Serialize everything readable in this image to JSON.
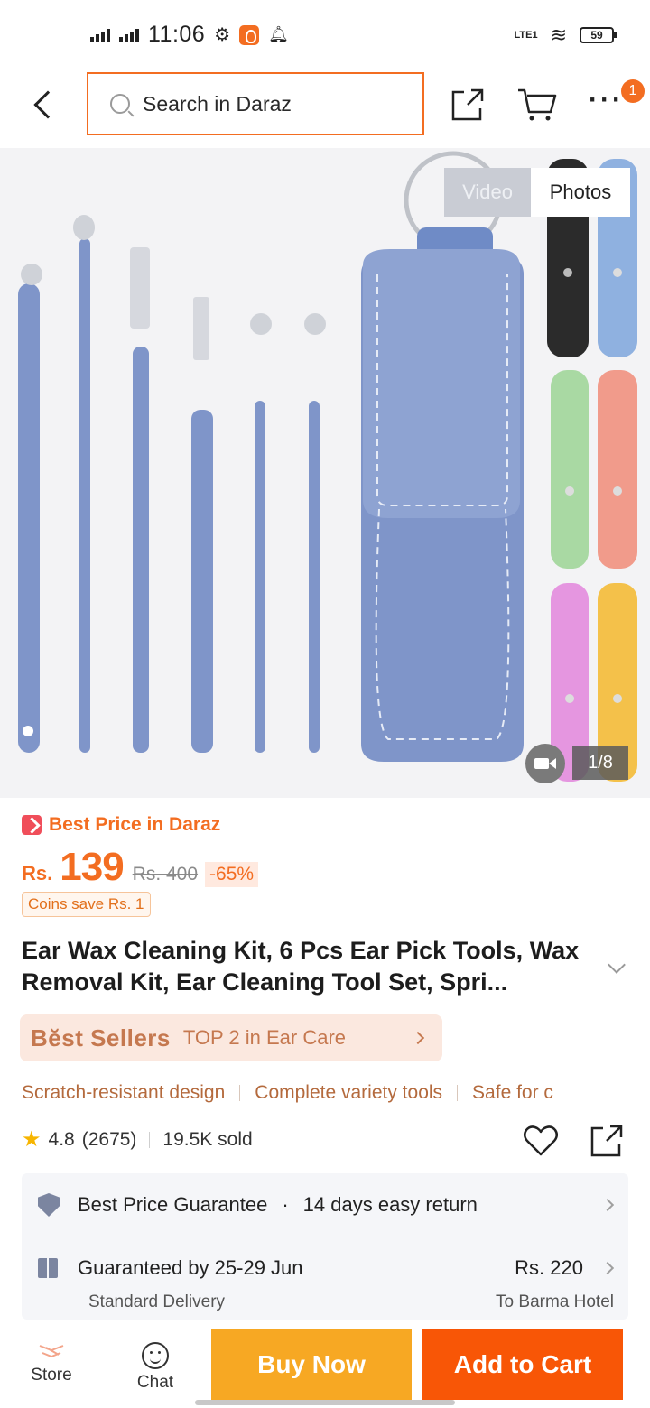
{
  "status_bar": {
    "time": "11:06",
    "network": "LTE1",
    "battery": "59"
  },
  "header": {
    "search_placeholder": "Search in Daraz",
    "cart_badge": "1"
  },
  "gallery": {
    "media_tabs": [
      "Video",
      "Photos"
    ],
    "active_tab": "Photos",
    "counter": "1/8",
    "case_colors": [
      "#5c7ec0",
      "#7f95c9",
      "#2b2b2b",
      "#8fb1e0",
      "#a9d9a3",
      "#f19b8b",
      "#e596e0",
      "#f4c14a"
    ]
  },
  "price": {
    "promo_label": "Best Price in Daraz",
    "currency": "Rs.",
    "current": "139",
    "original": "Rs. 400",
    "discount": "-65%",
    "coins": "Coins save Rs. 1"
  },
  "product": {
    "title": "Ear Wax Cleaning Kit, 6 Pcs Ear Pick Tools, Wax Removal Kit, Ear Cleaning Tool Set, Spri..."
  },
  "best_sellers": {
    "brand": "Bĕst Sellers",
    "rank": "TOP 2 in Ear Care"
  },
  "features": [
    "Scratch-resistant design",
    "Complete variety tools",
    "Safe for c"
  ],
  "rating": {
    "score": "4.8",
    "count": "(2675)",
    "sold": "19.5K sold"
  },
  "services": {
    "guarantee": "Best Price Guarantee",
    "return_policy": "14 days easy return",
    "delivery": "Guaranteed by 25-29 Jun",
    "delivery_fee": "Rs. 220",
    "delivery_type": "Standard Delivery",
    "destination": "To Barma Hotel"
  },
  "bottom_bar": {
    "store_label": "Store",
    "chat_label": "Chat",
    "buy_now": "Buy Now",
    "add_to_cart": "Add to Cart"
  },
  "colors": {
    "accent": "#f36d21",
    "buy_now_bg": "#f7a823",
    "add_to_cart_bg": "#f85606",
    "best_sellers_text": "#c5784f"
  }
}
